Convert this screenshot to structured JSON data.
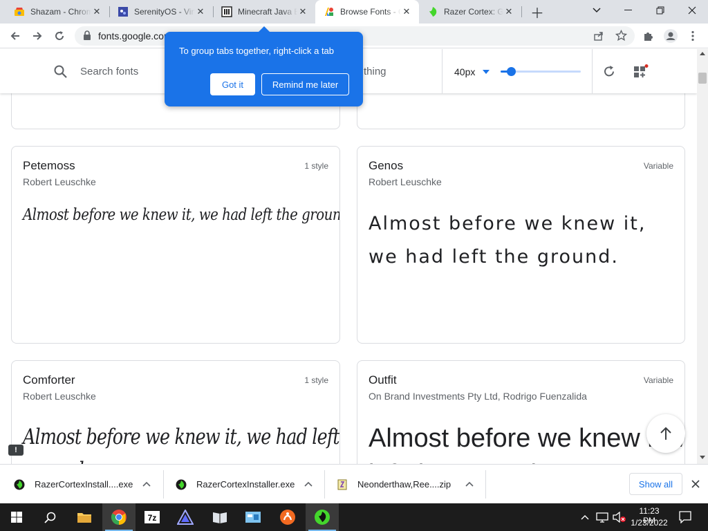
{
  "browser": {
    "tabs": [
      {
        "title": "Shazam - Chrome Web Store",
        "icon": "chrome-web-store-icon",
        "active": false
      },
      {
        "title": "SerenityOS - Virtual Machine",
        "icon": "serenity-icon",
        "active": false
      },
      {
        "title": "Minecraft Java Edition",
        "icon": "minecraft-icon",
        "active": false
      },
      {
        "title": "Browse Fonts - Google Fonts",
        "icon": "google-fonts-icon",
        "active": true
      },
      {
        "title": "Razer Cortex: Game Booster",
        "icon": "razer-icon",
        "active": false
      }
    ],
    "url": "fonts.google.com"
  },
  "popup": {
    "message": "To group tabs together, right-click a tab",
    "got_it": "Got it",
    "remind_later": "Remind me later"
  },
  "fonts_header": {
    "search_placeholder": "Search fonts",
    "preview_text_partial": "thing",
    "size_label": "40px",
    "slider_level": 0.13
  },
  "font_cards": [
    {
      "name": "Petemoss",
      "designer": "Robert Leuschke",
      "styles": "1 style",
      "sample": "Almost before we knew it, we had left the ground."
    },
    {
      "name": "Genos",
      "designer": "Robert Leuschke",
      "styles": "Variable",
      "sample": "Almost before we knew it, we had left the ground."
    },
    {
      "name": "Comforter",
      "designer": "Robert Leuschke",
      "styles": "1 style",
      "sample": "Almost before we knew it, we had left the ground."
    },
    {
      "name": "Outfit",
      "designer": "On Brand Investments Pty Ltd, Rodrigo Fuenzalida",
      "styles": "Variable",
      "sample": "Almost before we knew it, we had left the ground."
    }
  ],
  "downloads": {
    "items": [
      {
        "name": "RazerCortexInstall....exe"
      },
      {
        "name": "RazerCortexInstaller.exe"
      },
      {
        "name": "Neonderthaw,Ree....zip"
      }
    ],
    "show_all": "Show all"
  },
  "taskbar": {
    "time": "11:23 PM",
    "date": "1/23/2022"
  },
  "colors": {
    "accent_blue": "#1a73e8",
    "razer_green": "#44d62c",
    "taskbar": "#1c1c1c"
  }
}
